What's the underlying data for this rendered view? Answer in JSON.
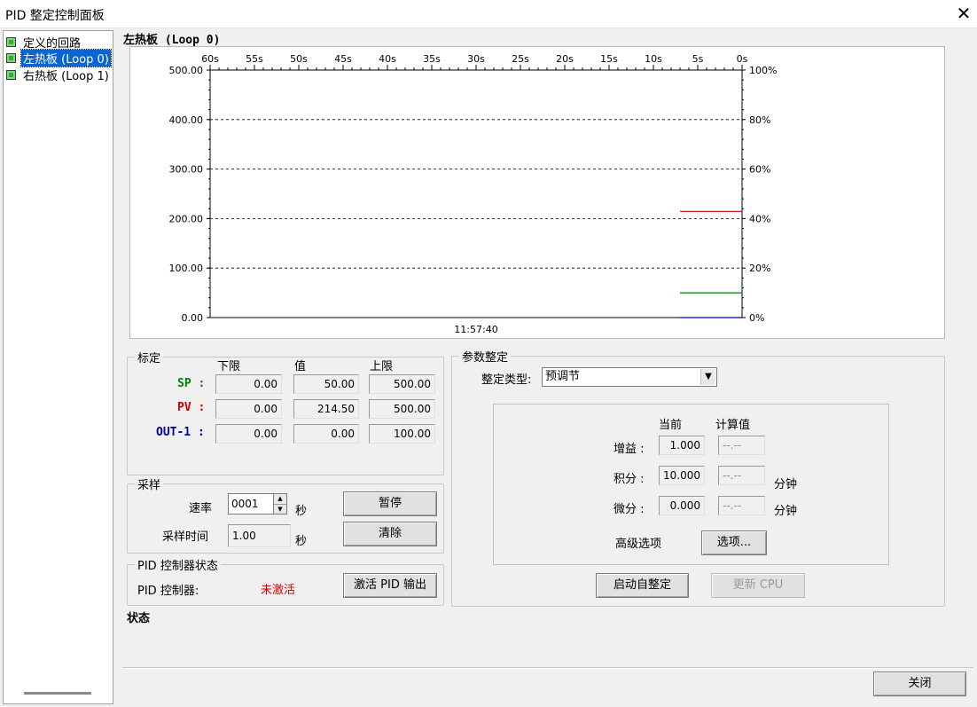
{
  "window": {
    "title": "PID 整定控制面板",
    "close_glyph": "✕"
  },
  "tree": {
    "items": [
      {
        "label": "定义的回路",
        "selected": false
      },
      {
        "label": "左热板 (Loop 0)",
        "selected": true
      },
      {
        "label": "右热板 (Loop 1)",
        "selected": false
      }
    ]
  },
  "chart_data": {
    "type": "line",
    "title": "左热板 (Loop 0)",
    "x_ticks": [
      "60s",
      "55s",
      "50s",
      "45s",
      "40s",
      "35s",
      "30s",
      "25s",
      "20s",
      "15s",
      "10s",
      "5s",
      "0s"
    ],
    "y_left_ticks": [
      "500.00",
      "400.00",
      "300.00",
      "200.00",
      "100.00",
      "0.00"
    ],
    "y_right_ticks": [
      "100%",
      "80%",
      "60%",
      "40%",
      "20%",
      "0%"
    ],
    "xlim": [
      60,
      0
    ],
    "ylim": [
      0,
      500
    ],
    "timestamp": "11:57:40",
    "grid": true,
    "series": [
      {
        "name": "PV",
        "color": "#d00000",
        "y": 214.5,
        "x_from": 7,
        "x_to": 0
      },
      {
        "name": "SP",
        "color": "#008000",
        "y": 50,
        "x_from": 7,
        "x_to": 0
      },
      {
        "name": "OUT-1",
        "color": "#0000cc",
        "y": 0,
        "x_from": 7,
        "x_to": 0
      }
    ]
  },
  "calibration": {
    "legend": "标定",
    "headers": {
      "low": "下限",
      "value": "值",
      "high": "上限"
    },
    "rows": [
      {
        "label": "SP :",
        "color": "#008000",
        "low": "0.00",
        "value": "50.00",
        "high": "500.00"
      },
      {
        "label": "PV :",
        "color": "#cc0000",
        "low": "0.00",
        "value": "214.50",
        "high": "500.00"
      },
      {
        "label": "OUT-1 :",
        "color": "#0000aa",
        "low": "0.00",
        "value": "0.00",
        "high": "100.00"
      }
    ]
  },
  "sampling": {
    "legend": "采样",
    "rate_label": "速率",
    "rate_value": "0001",
    "rate_unit": "秒",
    "time_label": "采样时间",
    "time_value": "1.00",
    "time_unit": "秒",
    "pause_button": "暂停",
    "clear_button": "清除"
  },
  "pid_status": {
    "legend": "PID 控制器状态",
    "label": "PID 控制器:",
    "state": "未激活",
    "state_color": "#d00000",
    "activate_button": "激活 PID 输出"
  },
  "status": {
    "label": "状态"
  },
  "tuning": {
    "legend": "参数整定",
    "type_label": "整定类型:",
    "type_value": "预调节",
    "headers": {
      "current": "当前",
      "computed": "计算值"
    },
    "gain": {
      "label": "增益 :",
      "current": "1.000",
      "computed": "--.--"
    },
    "integral": {
      "label": "积分 :",
      "current": "10.000",
      "computed": "--.--",
      "unit": "分钟"
    },
    "derivative": {
      "label": "微分 :",
      "current": "0.000",
      "computed": "--.--",
      "unit": "分钟"
    },
    "advanced_label": "高级选项",
    "options_button": "选项...",
    "start_button": "启动自整定",
    "update_button": "更新 CPU"
  },
  "footer": {
    "close_button": "关闭"
  }
}
